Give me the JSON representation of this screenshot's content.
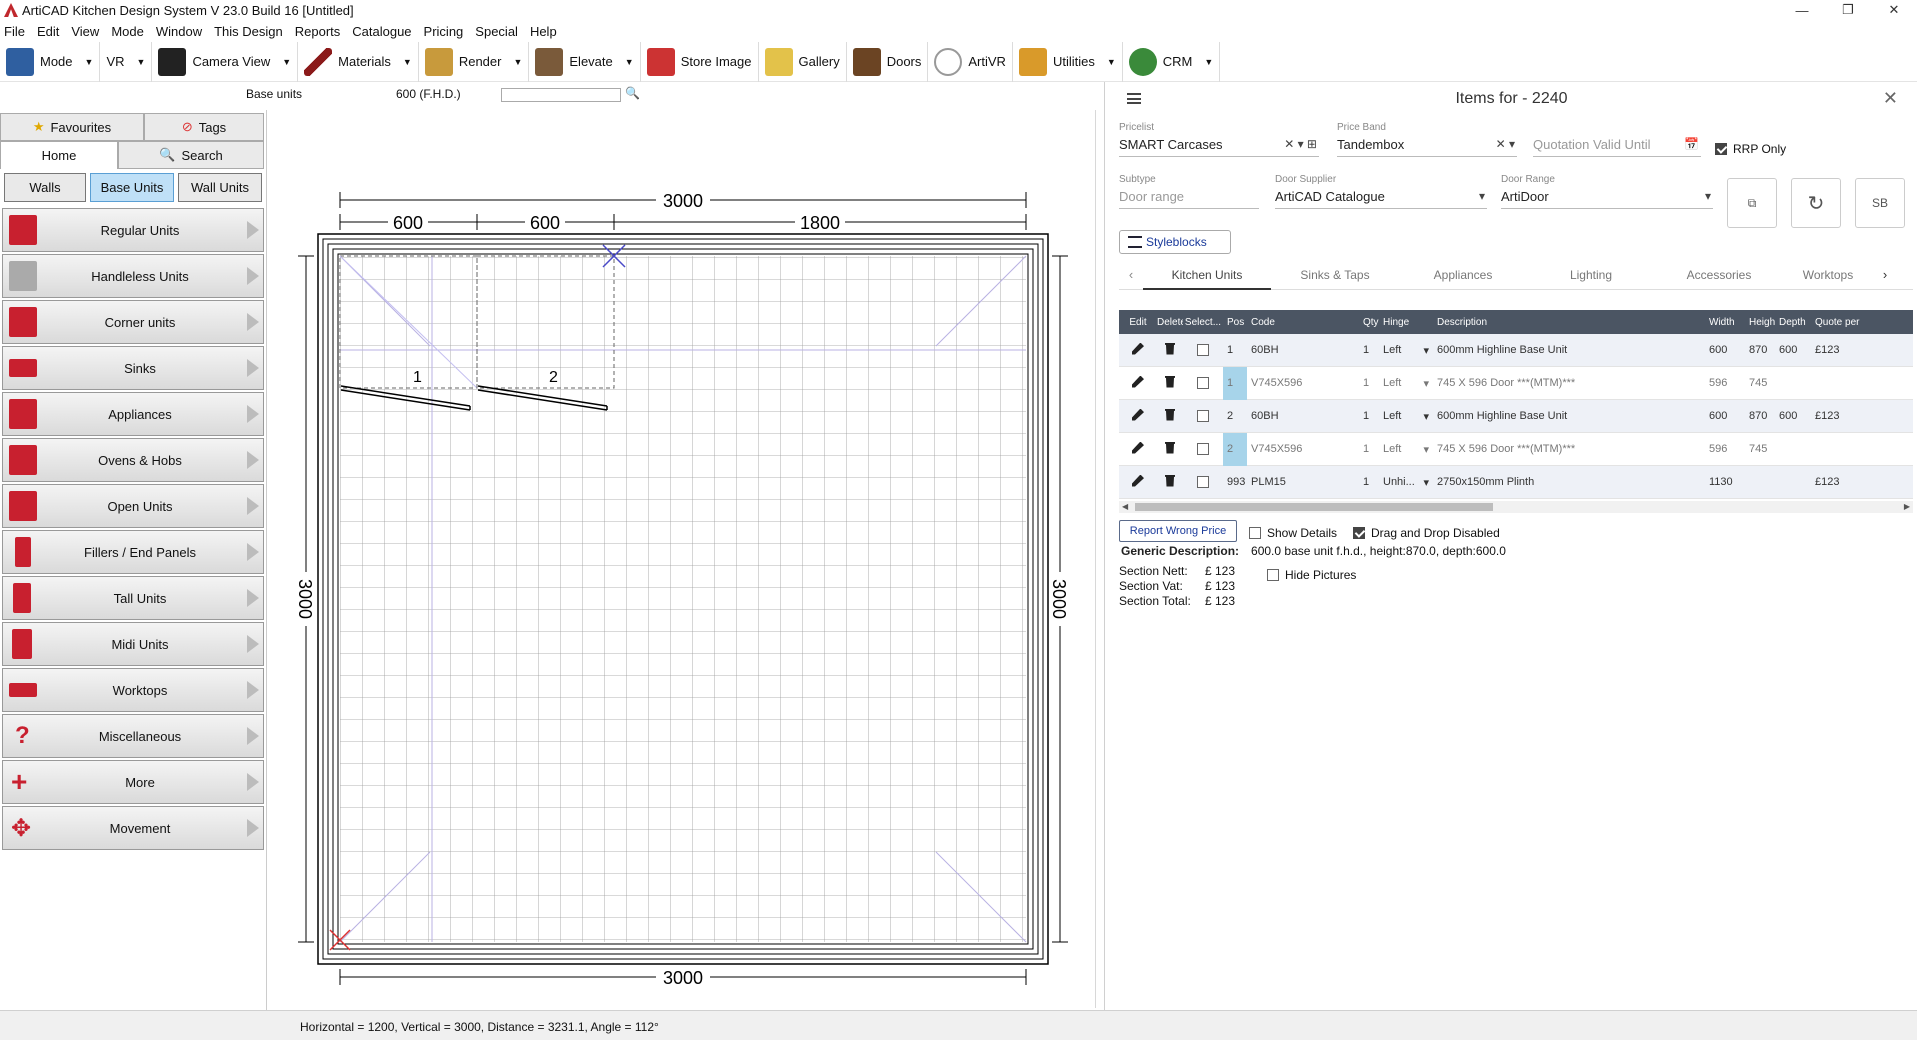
{
  "window": {
    "title": "ArtiCAD Kitchen Design System  V 23.0 Build 16  [Untitled]",
    "min": "—",
    "max": "❐",
    "close": "✕"
  },
  "menu": [
    "File",
    "Edit",
    "View",
    "Mode",
    "Window",
    "This Design",
    "Reports",
    "Catalogue",
    "Pricing",
    "Special",
    "Help"
  ],
  "toolbar": {
    "mode": "Mode",
    "vr": "VR",
    "camera": "Camera View",
    "materials": "Materials",
    "render": "Render",
    "elevate": "Elevate",
    "store_image": "Store Image",
    "gallery": "Gallery",
    "doors": "Doors",
    "artivr": "ArtiVR",
    "utilities": "Utilities",
    "crm": "CRM"
  },
  "subbar": {
    "label": "Base units",
    "size": "600 (F.H.D.)",
    "search_placeholder": ""
  },
  "left": {
    "tabs_top": [
      "Favourites",
      "Tags"
    ],
    "tabs_bottom": [
      "Home",
      "Search"
    ],
    "cat_tabs": [
      "Walls",
      "Base Units",
      "Wall Units"
    ],
    "items": [
      "Regular Units",
      "Handleless Units",
      "Corner units",
      "Sinks",
      "Appliances",
      "Ovens & Hobs",
      "Open Units",
      "Fillers / End Panels",
      "Tall Units",
      "Midi Units",
      "Worktops",
      "Miscellaneous",
      "More",
      "Movement"
    ]
  },
  "plan": {
    "width_top": "3000",
    "width_bottom": "3000",
    "height_left": "3000",
    "height_right": "3000",
    "seg1": "600",
    "seg2": "600",
    "seg3": "1800",
    "unit1": "1",
    "unit2": "2"
  },
  "status": "Horizontal = 1200, Vertical = 3000, Distance = 3231.1, Angle = 112°",
  "right": {
    "title": "Items for - 2240",
    "pricelist_label": "Pricelist",
    "pricelist": "SMART Carcases",
    "priceband_label": "Price Band",
    "priceband": "Tandembox",
    "quotation_placeholder": "Quotation Valid Until",
    "rrp_only": "RRP Only",
    "subtype_label": "Subtype",
    "subtype_placeholder": "Door range",
    "door_supplier_label": "Door Supplier",
    "door_supplier": "ArtiCAD Catalogue",
    "door_range_label": "Door Range",
    "door_range": "ArtiDoor",
    "sb": "SB",
    "styleblocks": "Styleblocks",
    "tabs": [
      "Kitchen Units",
      "Sinks & Taps",
      "Appliances",
      "Lighting",
      "Accessories",
      "Worktops"
    ],
    "headers": [
      "Edit",
      "Delete",
      "Select...",
      "Pos",
      "Code",
      "Qty",
      "Hinge",
      "Description",
      "Width",
      "Height",
      "Depth",
      "Quote per u"
    ],
    "rows": [
      {
        "pos": "1",
        "code": "60BH",
        "qty": "1",
        "hinge": "Left",
        "desc": "600mm Highline Base Unit",
        "width": "600",
        "height": "870",
        "depth": "600",
        "quote": "£123"
      },
      {
        "pos": "1",
        "code": "V745X596",
        "qty": "1",
        "hinge": "Left",
        "desc": "745 X 596 Door ***(MTM)***",
        "width": "596",
        "height": "745",
        "depth": "",
        "quote": ""
      },
      {
        "pos": "2",
        "code": "60BH",
        "qty": "1",
        "hinge": "Left",
        "desc": "600mm Highline Base Unit",
        "width": "600",
        "height": "870",
        "depth": "600",
        "quote": "£123"
      },
      {
        "pos": "2",
        "code": "V745X596",
        "qty": "1",
        "hinge": "Left",
        "desc": "745 X 596 Door ***(MTM)***",
        "width": "596",
        "height": "745",
        "depth": "",
        "quote": ""
      },
      {
        "pos": "993",
        "code": "PLM15",
        "qty": "1",
        "hinge": "Unhi...",
        "desc": "2750x150mm Plinth",
        "width": "1130",
        "height": "",
        "depth": "",
        "quote": "£123"
      }
    ],
    "report_wrong_price": "Report Wrong Price",
    "show_details": "Show Details",
    "drag_drop": "Drag and Drop Disabled",
    "hide_pictures": "Hide Pictures",
    "generic_label": "Generic Description:",
    "generic_value": "600.0 base unit f.h.d., height:870.0, depth:600.0",
    "section_nett_label": "Section Nett:",
    "section_nett": "£ 123",
    "section_vat_label": "Section Vat:",
    "section_vat": "£ 123",
    "section_total_label": "Section Total:",
    "section_total": "£ 123"
  },
  "colors": {
    "accent": "#c8202f",
    "grid_header": "#4b5563",
    "selected_tab": "#bfe0f7"
  }
}
